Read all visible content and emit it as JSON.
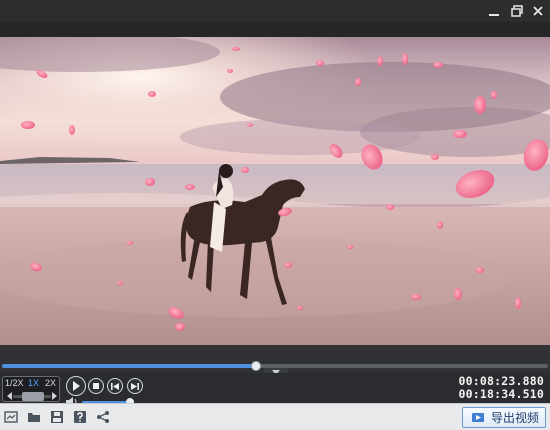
{
  "video": {
    "scene": "beach-horse-rider-rose-petals"
  },
  "playback": {
    "progress": 0.465,
    "speed_options": [
      "1/2X",
      "1X",
      "2X"
    ],
    "active_speed": "1X",
    "volume": 0.95,
    "current_time": "00:08:23.880",
    "total_time": "00:18:34.510"
  },
  "toolbar": {
    "export_label": "导出视频"
  },
  "colors": {
    "accent": "#4e8fe0",
    "titlebar": "#2d2d2d",
    "toolbar": "#e8e9eb",
    "petal": "#f06b8f"
  },
  "icons": {
    "minimize": "minimize-icon",
    "maximize": "restore-icon",
    "close": "close-icon",
    "play": "play-icon",
    "stop": "stop-icon",
    "prev": "previous-icon",
    "next": "next-icon",
    "volume": "volume-icon",
    "toolbar": [
      "open-file-icon",
      "folder-icon",
      "save-icon",
      "help-icon",
      "share-icon"
    ],
    "export": "export-video-icon"
  }
}
